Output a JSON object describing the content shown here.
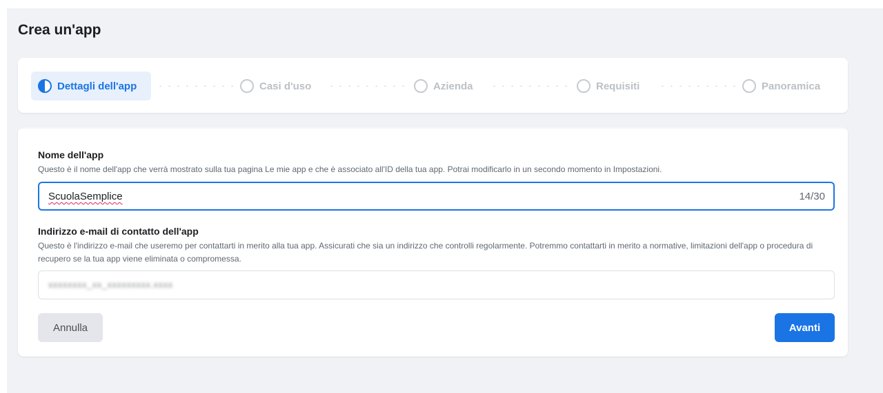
{
  "page": {
    "title": "Crea un'app"
  },
  "stepper": {
    "steps": [
      {
        "label": "Dettagli dell'app",
        "state": "active"
      },
      {
        "label": "Casi d'uso",
        "state": "pending"
      },
      {
        "label": "Azienda",
        "state": "pending"
      },
      {
        "label": "Requisiti",
        "state": "pending"
      },
      {
        "label": "Panoramica",
        "state": "pending"
      }
    ]
  },
  "form": {
    "app_name": {
      "label": "Nome dell'app",
      "help": "Questo è il nome dell'app che verrà mostrato sulla tua pagina Le mie app e che è associato all'ID della tua app. Potrai modificarlo in un secondo momento in Impostazioni.",
      "value": "ScuolaSemplice",
      "counter": "14/30"
    },
    "contact_email": {
      "label": "Indirizzo e-mail di contatto dell'app",
      "help": "Questo è l'indirizzo e-mail che useremo per contattarti in merito alla tua app. Assicurati che sia un indirizzo che controlli regolarmente. Potremmo contattarti in merito a normative, limitazioni dell'app o procedura di recupero se la tua app viene eliminata o compromessa."
    },
    "buttons": {
      "cancel": "Annulla",
      "next": "Avanti"
    }
  },
  "colors": {
    "accent": "#1b74e4",
    "background": "#f0f2f5",
    "active_step_bg": "#e7f0fb"
  }
}
